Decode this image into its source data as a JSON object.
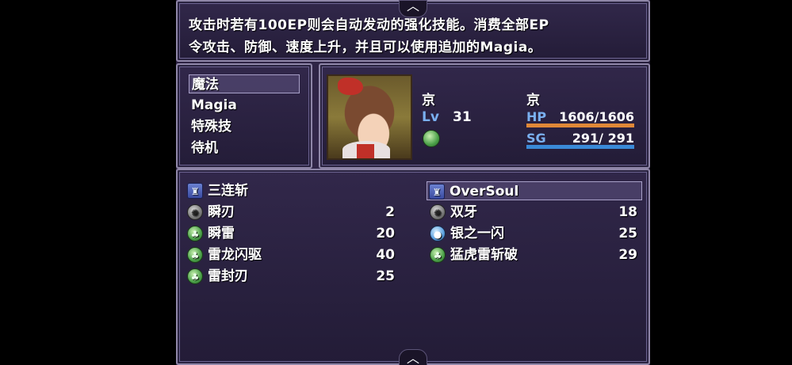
{
  "help": {
    "line1": "攻击时若有100EP则会自动发动的强化技能。消费全部EP",
    "line2": "令攻击、防御、速度上升，并且可以使用追加的Magia。"
  },
  "commands": [
    {
      "label": "魔法",
      "selected": true
    },
    {
      "label": "Magia",
      "selected": false
    },
    {
      "label": "特殊技",
      "selected": false
    },
    {
      "label": "待机",
      "selected": false
    }
  ],
  "actor": {
    "name": "京",
    "nickname": "京",
    "lv_label": "Lv",
    "level": "31",
    "state_icon": "wind-orb-icon",
    "hp_label": "HP",
    "hp": "1606/1606",
    "hp_fraction": 1.0,
    "sg_label": "SG",
    "sg": "291/ 291",
    "sg_fraction": 1.0,
    "colors": {
      "hp_gauge": "#e08838",
      "sg_gauge": "#3a8ad8",
      "system_label": "#7ab0f0"
    }
  },
  "skills": [
    {
      "name": "三连斩",
      "cost": "",
      "icon": "magia-icon",
      "selected": false
    },
    {
      "name": "OverSoul",
      "cost": "",
      "icon": "magia-icon",
      "selected": true
    },
    {
      "name": "瞬刃",
      "cost": "2",
      "icon": "gray-orb-icon",
      "selected": false
    },
    {
      "name": "双牙",
      "cost": "18",
      "icon": "gray-orb-icon",
      "selected": false
    },
    {
      "name": "瞬雷",
      "cost": "20",
      "icon": "wind-orb-icon",
      "selected": false
    },
    {
      "name": "银之一闪",
      "cost": "25",
      "icon": "water-orb-icon",
      "selected": false
    },
    {
      "name": "雷龙闪驱",
      "cost": "40",
      "icon": "wind-orb-icon",
      "selected": false
    },
    {
      "name": "猛虎雷斩破",
      "cost": "29",
      "icon": "wind-orb-icon",
      "selected": false
    },
    {
      "name": "雷封刃",
      "cost": "25",
      "icon": "wind-orb-icon",
      "selected": false
    }
  ]
}
